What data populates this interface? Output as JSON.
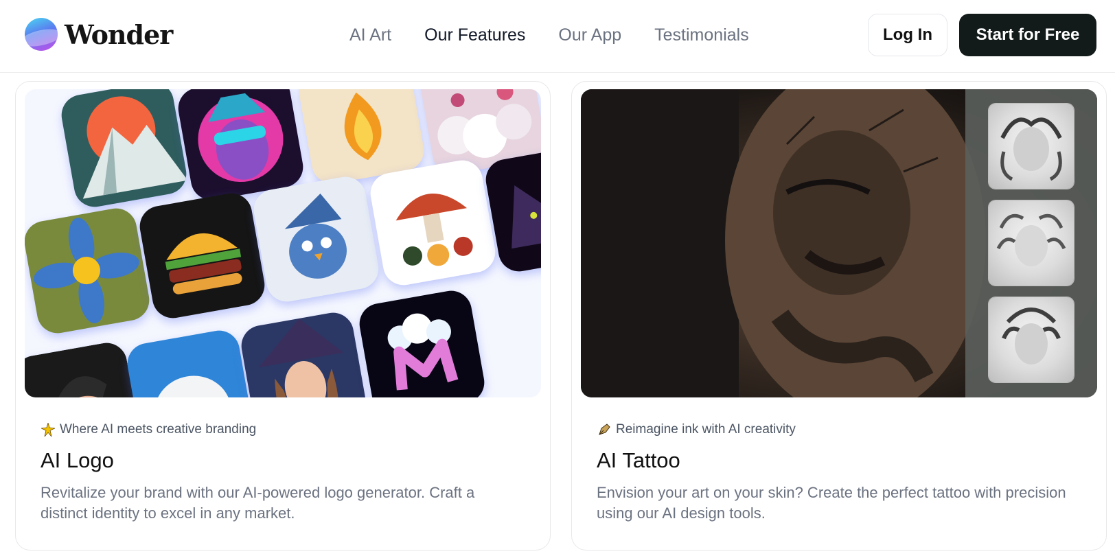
{
  "brand": {
    "name": "Wonder"
  },
  "nav": {
    "items": [
      {
        "label": "AI Art"
      },
      {
        "label": "Our Features"
      },
      {
        "label": "Our App"
      },
      {
        "label": "Testimonials"
      }
    ],
    "active": "Our Features"
  },
  "actions": {
    "login": "Log In",
    "start": "Start for Free"
  },
  "cards": [
    {
      "tag_icon": "sparkle-icon",
      "tagline": "Where AI meets creative branding",
      "title": "AI Logo",
      "description": "Revitalize your brand with our AI-powered logo generator. Craft a distinct identity to excel in any market."
    },
    {
      "tag_icon": "pen-nib-icon",
      "tagline": "Reimagine ink with AI creativity",
      "title": "AI Tattoo",
      "description": "Envision your art on your skin? Create the perfect tattoo with precision using our AI design tools."
    }
  ],
  "colors": {
    "accent_dark": "#121a1a",
    "nav_muted": "#6b7280",
    "nav_active": "#111827"
  }
}
